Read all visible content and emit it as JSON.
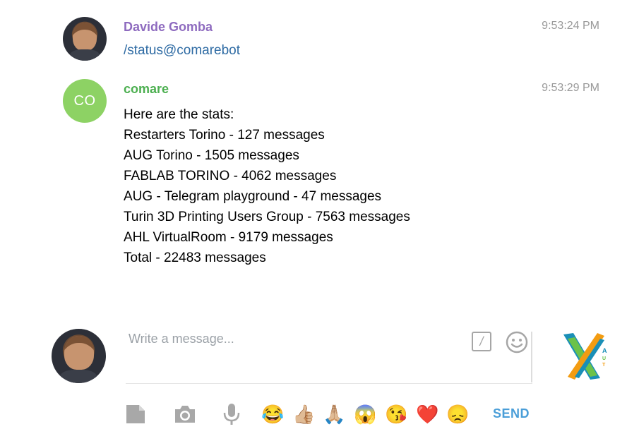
{
  "messages": [
    {
      "sender": "Davide Gomba",
      "time": "9:53:24 PM",
      "text": "/status@comarebot"
    },
    {
      "sender": "comare",
      "avatar_initials": "CO",
      "time": "9:53:29 PM",
      "lines": [
        "Here are the stats:",
        "Restarters Torino - 127 messages",
        "AUG Torino - 1505 messages",
        "FABLAB TORINO - 4062 messages",
        "AUG - Telegram playground - 47 messages",
        "Turin 3D Printing Users Group - 7563 messages",
        "AHL VirtualRoom - 9179 messages",
        "Total - 22483 messages"
      ]
    }
  ],
  "composer": {
    "placeholder": "Write a message...",
    "command_symbol": "/"
  },
  "toolbar": {
    "icons": [
      "document-icon",
      "camera-icon",
      "microphone-icon"
    ],
    "quick_emojis": [
      "😂",
      "👍🏼",
      "🙏🏼",
      "😱",
      "😘",
      "❤️",
      "😞"
    ],
    "send_label": "SEND"
  },
  "colors": {
    "sender_purple": "#8e6bbf",
    "sender_green": "#4caf50",
    "command_link": "#2d6aa3",
    "initials_avatar_bg": "#8dd264",
    "send_blue": "#4a9ed8",
    "timestamp_gray": "#999999"
  }
}
